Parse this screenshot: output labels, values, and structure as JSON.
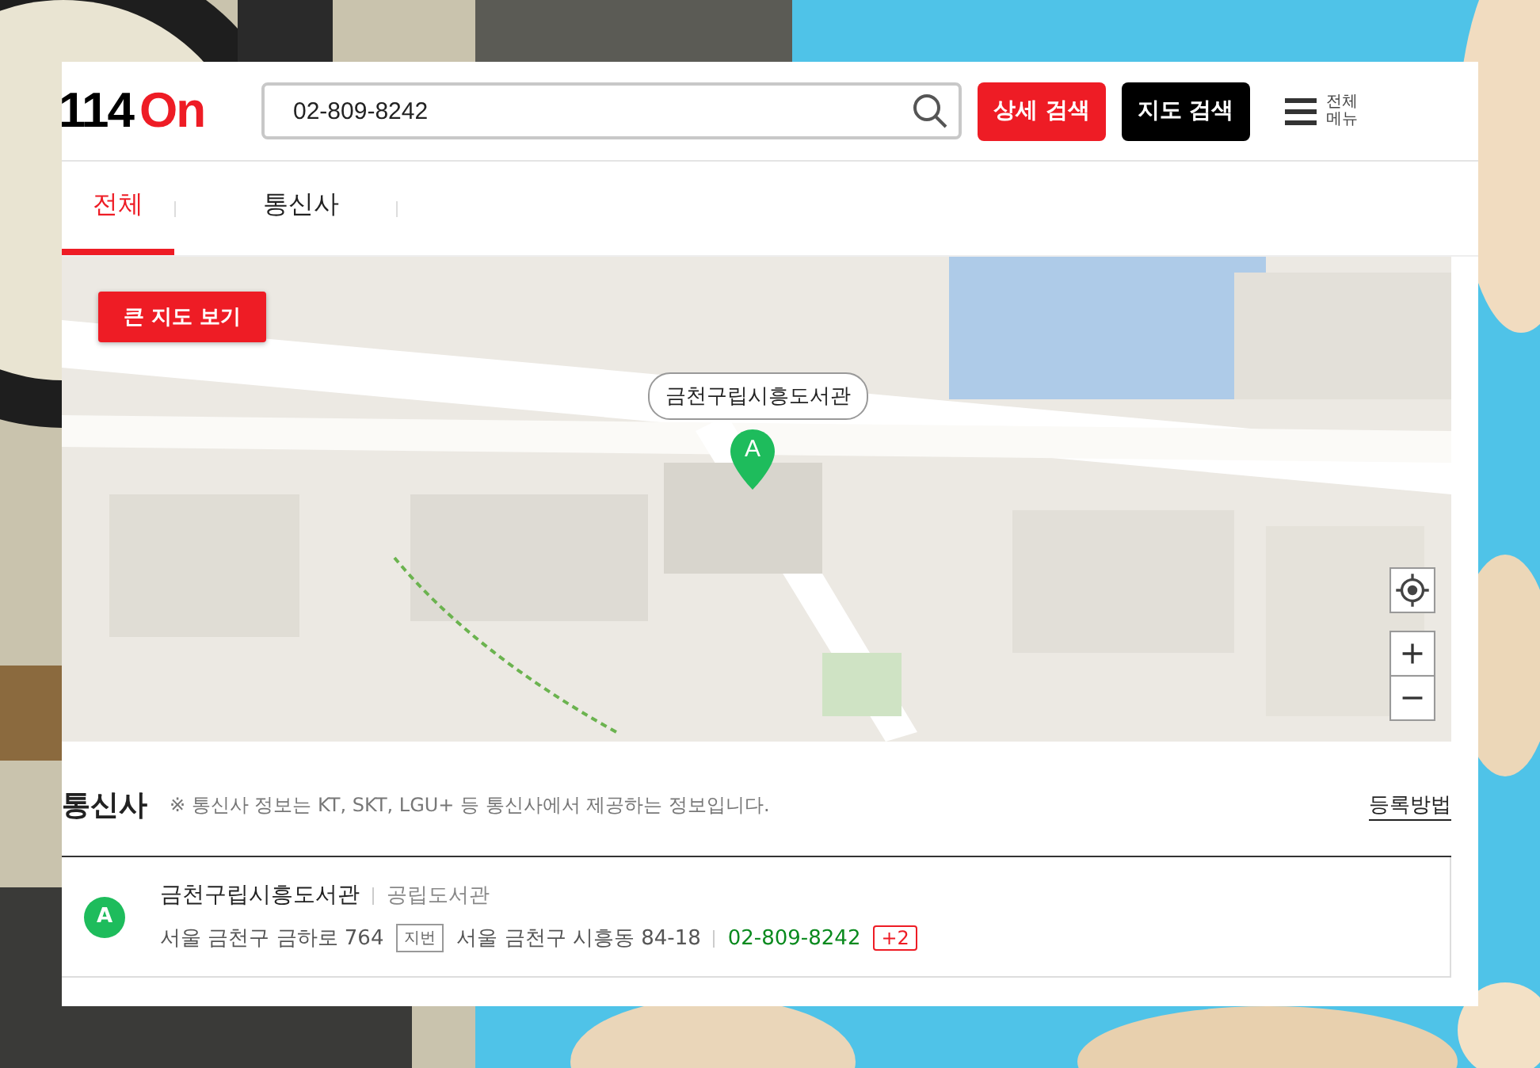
{
  "logo": {
    "digits": "114",
    "suffix": "On"
  },
  "search": {
    "value": "02-809-8242"
  },
  "header_buttons": [
    {
      "label": "상세 검색",
      "kind": "primary"
    },
    {
      "label": "지도 검색",
      "kind": "dark"
    }
  ],
  "menu": {
    "line1": "전체",
    "line2": "메뉴"
  },
  "tabs": [
    {
      "label": "전체",
      "selected": true
    },
    {
      "label": "통신사",
      "selected": false
    }
  ],
  "map": {
    "kind": "picture",
    "big_map_button": "큰 지도 보기",
    "marker": {
      "letter": "A",
      "label": "금천구립시흥도서관"
    }
  },
  "section": {
    "title": "통신사",
    "note": "※ 통신사 정보는 KT, SKT, LGU+ 등 통신사에서 제공하는 정보입니다.",
    "link": "등록방법"
  },
  "results": [
    {
      "letter": "A",
      "name": "금천구립시흥도서관",
      "category": "공립도서관",
      "road_address": "서울 금천구 금하로 764",
      "lot_tag": "지번",
      "lot_address": "서울 금천구 시흥동 84-18",
      "phone": "02-809-8242",
      "more": "+2"
    }
  ]
}
